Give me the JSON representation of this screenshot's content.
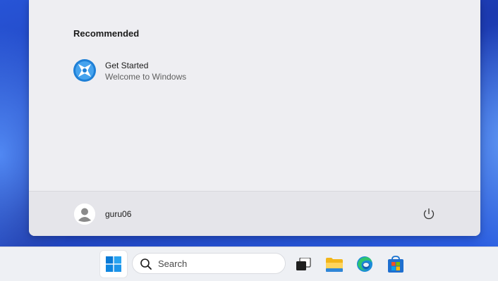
{
  "start_menu": {
    "recommended_heading": "Recommended",
    "recommended_items": [
      {
        "title": "Get Started",
        "subtitle": "Welcome to Windows",
        "icon": "get-started-icon"
      }
    ],
    "user": {
      "name": "guru06",
      "icon": "user-avatar-icon"
    },
    "power_icon": "power-icon"
  },
  "taskbar": {
    "start_icon": "windows-logo-icon",
    "search": {
      "placeholder": "Search",
      "icon": "search-icon"
    },
    "pinned": [
      {
        "name": "Task View",
        "icon": "task-view-icon"
      },
      {
        "name": "File Explorer",
        "icon": "folder-icon"
      },
      {
        "name": "Microsoft Edge",
        "icon": "edge-icon"
      },
      {
        "name": "Microsoft Store",
        "icon": "store-icon"
      }
    ]
  },
  "colors": {
    "accent": "#0067c0",
    "menu_background": "#eeeef2",
    "taskbar_background": "#eef0f4"
  }
}
